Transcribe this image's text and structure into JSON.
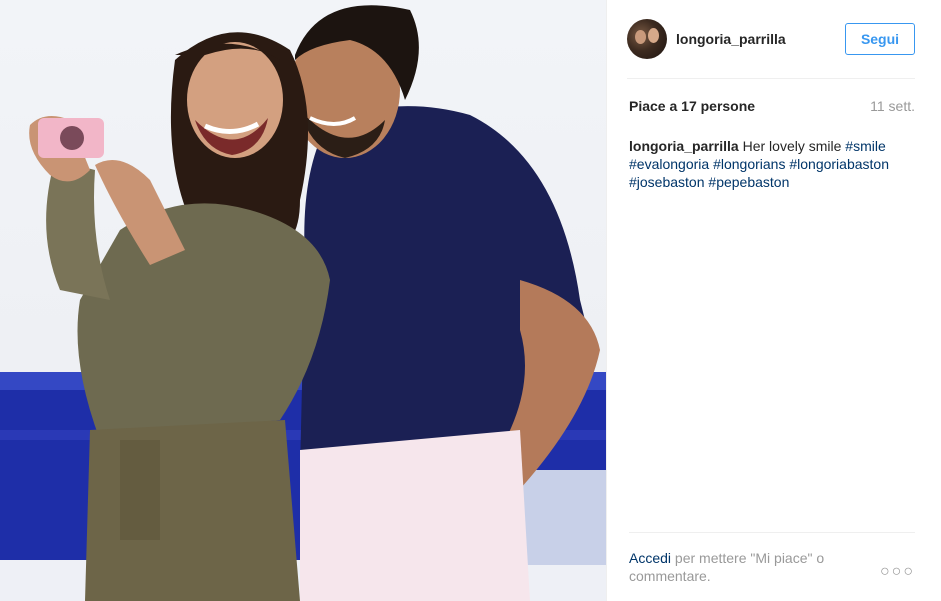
{
  "post": {
    "photo_alt": "",
    "header": {
      "username": "longoria_parrilla",
      "follow_label": "Segui",
      "avatar_icon": "avatar-photo"
    },
    "likes_text": "Piace a 17 persone",
    "time_text": "11 sett.",
    "caption": {
      "username": "longoria_parrilla",
      "text": "Her lovely smile",
      "hashtags": [
        "#smile",
        "#evalongoria",
        "#longorians",
        "#longoriabaston",
        "#josebaston",
        "#pepebaston"
      ]
    },
    "footer": {
      "login_link": "Accedi",
      "login_rest": "per mettere \"Mi piace\" o commentare.",
      "more_icon": "more-options-icon"
    },
    "colors": {
      "link": "#3897f0",
      "hashtag": "#003569",
      "muted": "#999999"
    }
  }
}
